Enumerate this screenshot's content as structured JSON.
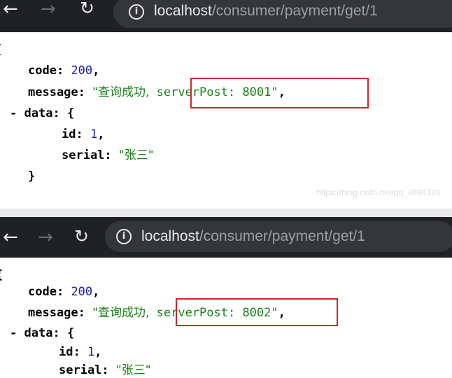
{
  "screens": [
    {
      "url_host": "localhost",
      "url_path": "/consumer/payment/get/1",
      "json": {
        "open_brace": "{",
        "code_key": "code:",
        "code_value": "200",
        "message_key": "message:",
        "message_prefix": "\"查询成功,",
        "message_highlight": "serverPost: 8001\"",
        "data_toggle": "-",
        "data_key": "data:",
        "data_open": "{",
        "id_key": "id:",
        "id_value": "1",
        "serial_key": "serial:",
        "serial_value": "\"张三\"",
        "data_close": "}"
      }
    },
    {
      "url_host": "localhost",
      "url_path": "/consumer/payment/get/1",
      "json": {
        "open_brace": "{",
        "code_key": "code:",
        "code_value": "200",
        "message_key": "message:",
        "message_prefix": "\"查询成功,",
        "message_highlight": "serverPost: 8002\"",
        "data_toggle": "-",
        "data_key": "data:",
        "data_open": "{",
        "id_key": "id:",
        "id_value": "1",
        "serial_key": "serial:",
        "serial_value": "\"张三\""
      }
    }
  ],
  "nav_icons": [
    "back-arrow-icon",
    "forward-arrow-icon",
    "reload-icon",
    "info-icon"
  ],
  "watermark": "https://blog.csdn.net/qq_3690326",
  "colors": {
    "toolbar": "#202124",
    "omnibox": "#35363a",
    "highlight_box": "#d9232a",
    "string": "#188018",
    "number": "#1a1aa6"
  }
}
